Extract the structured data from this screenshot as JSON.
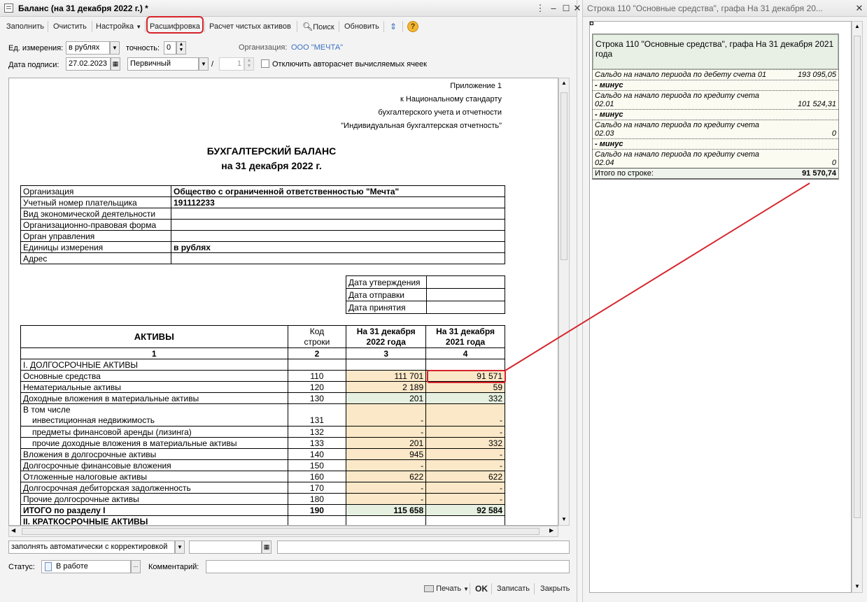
{
  "left_window": {
    "title": "Баланс (на 31 декабря 2022 г.) *",
    "toolbar": {
      "fill": "Заполнить",
      "clear": "Очистить",
      "settings": "Настройка",
      "decode": "Расшифровка",
      "net_assets": "Расчет чистых активов",
      "search": "Поиск",
      "refresh": "Обновить"
    },
    "params": {
      "unit_label": "Ед. измерения:",
      "unit_value": "в рублях",
      "precision_label": "точность:",
      "precision_value": "0",
      "org_label": "Организация:",
      "org_value": "ООО \"МЕЧТА\"",
      "sign_date_label": "Дата подписи:",
      "sign_date_value": "27.02.2023",
      "kind_value": "Первичный",
      "slash": "/",
      "correction_number": "1",
      "autocalc_label": "Отключить авторасчет вычисляемых ячеек"
    },
    "document": {
      "appendix": [
        "Приложение 1",
        "к Национальному стандарту",
        "бухгалтерского учета и отчетности",
        "\"Индивидуальная бухгалтерская отчетность\""
      ],
      "title": "БУХГАЛТЕРСКИЙ БАЛАНС",
      "subtitle": "на 31 декабря 2022 г.",
      "org_info": [
        {
          "label": "Организация",
          "value": "Общество с ограниченной ответственностью \"Мечта\""
        },
        {
          "label": "Учетный номер плательщика",
          "value": "191112233"
        },
        {
          "label": "Вид экономической деятельности",
          "value": ""
        },
        {
          "label": "Организационно-правовая форма",
          "value": ""
        },
        {
          "label": "Орган управления",
          "value": ""
        },
        {
          "label": "Единицы измерения",
          "value": "в рублях"
        },
        {
          "label": "Адрес",
          "value": ""
        }
      ],
      "dates": [
        {
          "label": "Дата утверждения",
          "value": ""
        },
        {
          "label": "Дата отправки",
          "value": ""
        },
        {
          "label": "Дата принятия",
          "value": ""
        }
      ],
      "balance_header": {
        "col1": "АКТИВЫ",
        "col2_line1": "Код",
        "col2_line2": "строки",
        "col3_line1": "На 31 декабря",
        "col3_line2": "2022 года",
        "col4_line1": "На 31 декабря",
        "col4_line2": "2021 года",
        "num1": "1",
        "num2": "2",
        "num3": "3",
        "num4": "4"
      },
      "section1_title": "I. ДОЛГОСРОЧНЫЕ АКТИВЫ",
      "rows": [
        {
          "name": "Основные средства",
          "code": "110",
          "y2022": "111 701",
          "y2021": "91 571"
        },
        {
          "name": "Нематериальные активы",
          "code": "120",
          "y2022": "2 189",
          "y2021": "59"
        },
        {
          "name": "Доходные вложения в материальные активы",
          "code": "130",
          "y2022": "201",
          "y2021": "332"
        }
      ],
      "incl_label": "В том числе",
      "sub_rows": [
        {
          "name": "инвестиционная недвижимость",
          "code": "131",
          "y2022": "-",
          "y2021": "-"
        },
        {
          "name": "предметы финансовой аренды (лизинга)",
          "code": "132",
          "y2022": "-",
          "y2021": "-"
        },
        {
          "name": "прочие доходные вложения в материальные активы",
          "code": "133",
          "y2022": "201",
          "y2021": "332"
        }
      ],
      "rows2": [
        {
          "name": "Вложения в долгосрочные активы",
          "code": "140",
          "y2022": "945",
          "y2021": "-"
        },
        {
          "name": "Долгосрочные финансовые вложения",
          "code": "150",
          "y2022": "-",
          "y2021": "-"
        },
        {
          "name": "Отложенные налоговые активы",
          "code": "160",
          "y2022": "622",
          "y2021": "622"
        },
        {
          "name": "Долгосрочная дебиторская задолженность",
          "code": "170",
          "y2022": "-",
          "y2021": "-"
        },
        {
          "name": "Прочие долгосрочные активы",
          "code": "180",
          "y2022": "-",
          "y2021": "-"
        }
      ],
      "total_row": {
        "name": "ИТОГО по разделу I",
        "code": "190",
        "y2022": "115 658",
        "y2021": "92 584"
      },
      "section2_title": "II. КРАТКОСРОЧНЫЕ АКТИВЫ"
    },
    "bottom": {
      "fill_mode": "заполнять автоматически с корректировкой",
      "status_label": "Статус:",
      "status_value": "В работе",
      "comment_label": "Комментарий:",
      "print": "Печать",
      "ok": "OK",
      "save": "Записать",
      "close": "Закрыть"
    }
  },
  "right_window": {
    "title": "Строка 110 \"Основные средства\", графа На 31 декабря 20...",
    "header": "Строка 110 \"Основные средства\", графа На 31 декабря 2021 года",
    "lines": [
      {
        "type": "line",
        "text": "Сальдо на начало периода по дебету счета 01",
        "value": "193 095,05"
      },
      {
        "type": "minus",
        "text": "- минус"
      },
      {
        "type": "line2",
        "text": "Сальдо на начало периода по кредиту счета",
        "account": "02.01",
        "value": "101 524,31"
      },
      {
        "type": "minus",
        "text": "- минус"
      },
      {
        "type": "line2",
        "text": "Сальдо на начало периода по кредиту счета",
        "account": "02.03",
        "value": "0"
      },
      {
        "type": "minus",
        "text": "- минус"
      },
      {
        "type": "line2",
        "text": "Сальдо на начало периода по кредиту счета",
        "account": "02.04",
        "value": "0"
      }
    ],
    "total_label": "Итого по строке:",
    "total_value": "91 570,74"
  },
  "colors": {
    "highlight_red": "#d6242b",
    "peach": "#fbe8c8",
    "green": "#e6f0e0",
    "link_blue": "#3a6fc4"
  }
}
